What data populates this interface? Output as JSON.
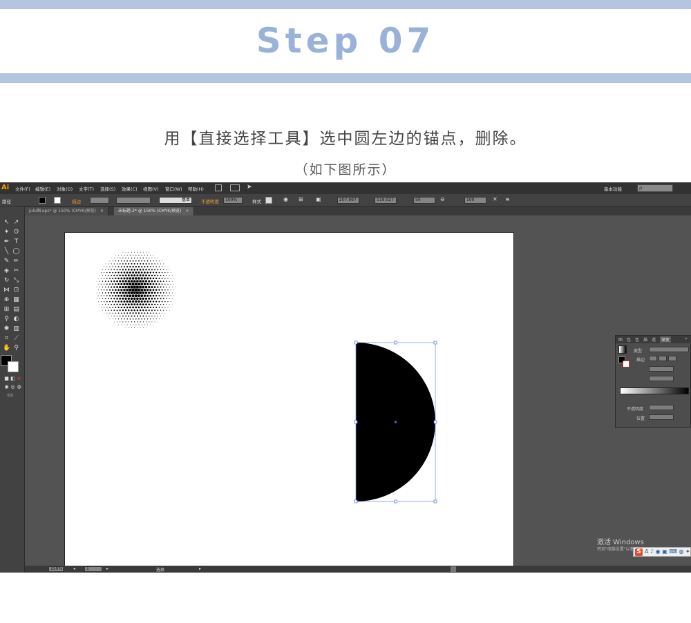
{
  "header": {
    "step_title": "Step 07",
    "instruction": "用【直接选择工具】选中圆左边的锚点，删除。",
    "caption": "（如下图所示）",
    "band_color": "#b4c5e0",
    "title_color": "#9bb2d8"
  },
  "app": {
    "logo": "Ai",
    "menu": [
      "文件(F)",
      "编辑(E)",
      "对象(O)",
      "文字(T)",
      "选择(S)",
      "效果(C)",
      "视图(V)",
      "窗口(W)",
      "帮助(H)"
    ],
    "workspace_label": "基本功能",
    "search_placeholder": "ρ"
  },
  "controlbar": {
    "selection_label": "路径",
    "stroke_label": "描边",
    "stroke_style": "基本",
    "opacity_label": "不透明度",
    "opacity_value": "100%",
    "style_label": "样式",
    "x_value": "207.997",
    "y_value": "119.027",
    "w_value": "50",
    "h_value": "100"
  },
  "tabs": [
    {
      "label": "julu图.eps* @ 150% (CMYK/预览)",
      "active": false
    },
    {
      "label": "未标题-2* @ 150% (CMYK/预览)",
      "active": true
    }
  ],
  "gradient_panel": {
    "tabs": [
      "图",
      "色",
      "色",
      "描",
      "透",
      "渐变"
    ],
    "type_label": "类型",
    "stroke_label": "描边",
    "opacity_label": "不透明度",
    "location_label": "位置"
  },
  "statusbar": {
    "zoom": "150%",
    "page": "1",
    "status_label": "选择"
  },
  "watermark": {
    "title": "激活 Windows",
    "subtitle": "转到\"电脑设置\"以激活 Windows。"
  },
  "ime": {
    "logo": "S",
    "text": "A ♪ ◉ ▣ ⌨ ◍ ✦"
  }
}
